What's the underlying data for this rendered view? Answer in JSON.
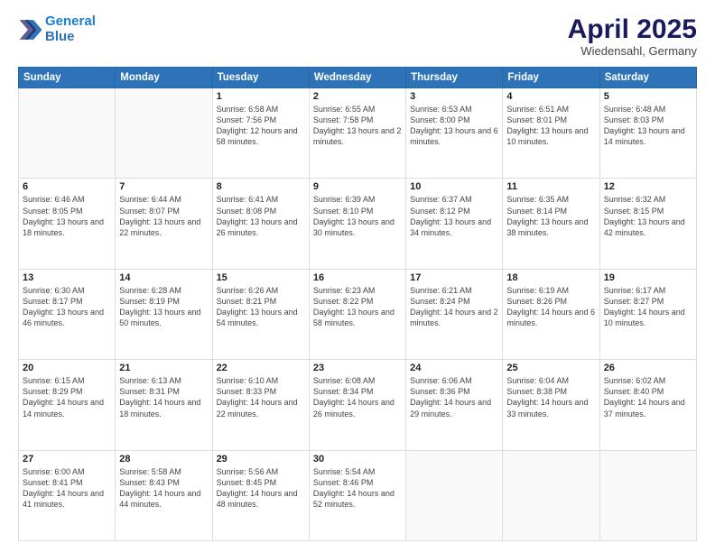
{
  "header": {
    "logo_general": "General",
    "logo_blue": "Blue",
    "month": "April 2025",
    "location": "Wiedensahl, Germany"
  },
  "days_of_week": [
    "Sunday",
    "Monday",
    "Tuesday",
    "Wednesday",
    "Thursday",
    "Friday",
    "Saturday"
  ],
  "weeks": [
    [
      {
        "day": "",
        "detail": ""
      },
      {
        "day": "",
        "detail": ""
      },
      {
        "day": "1",
        "detail": "Sunrise: 6:58 AM\nSunset: 7:56 PM\nDaylight: 12 hours and 58 minutes."
      },
      {
        "day": "2",
        "detail": "Sunrise: 6:55 AM\nSunset: 7:58 PM\nDaylight: 13 hours and 2 minutes."
      },
      {
        "day": "3",
        "detail": "Sunrise: 6:53 AM\nSunset: 8:00 PM\nDaylight: 13 hours and 6 minutes."
      },
      {
        "day": "4",
        "detail": "Sunrise: 6:51 AM\nSunset: 8:01 PM\nDaylight: 13 hours and 10 minutes."
      },
      {
        "day": "5",
        "detail": "Sunrise: 6:48 AM\nSunset: 8:03 PM\nDaylight: 13 hours and 14 minutes."
      }
    ],
    [
      {
        "day": "6",
        "detail": "Sunrise: 6:46 AM\nSunset: 8:05 PM\nDaylight: 13 hours and 18 minutes."
      },
      {
        "day": "7",
        "detail": "Sunrise: 6:44 AM\nSunset: 8:07 PM\nDaylight: 13 hours and 22 minutes."
      },
      {
        "day": "8",
        "detail": "Sunrise: 6:41 AM\nSunset: 8:08 PM\nDaylight: 13 hours and 26 minutes."
      },
      {
        "day": "9",
        "detail": "Sunrise: 6:39 AM\nSunset: 8:10 PM\nDaylight: 13 hours and 30 minutes."
      },
      {
        "day": "10",
        "detail": "Sunrise: 6:37 AM\nSunset: 8:12 PM\nDaylight: 13 hours and 34 minutes."
      },
      {
        "day": "11",
        "detail": "Sunrise: 6:35 AM\nSunset: 8:14 PM\nDaylight: 13 hours and 38 minutes."
      },
      {
        "day": "12",
        "detail": "Sunrise: 6:32 AM\nSunset: 8:15 PM\nDaylight: 13 hours and 42 minutes."
      }
    ],
    [
      {
        "day": "13",
        "detail": "Sunrise: 6:30 AM\nSunset: 8:17 PM\nDaylight: 13 hours and 46 minutes."
      },
      {
        "day": "14",
        "detail": "Sunrise: 6:28 AM\nSunset: 8:19 PM\nDaylight: 13 hours and 50 minutes."
      },
      {
        "day": "15",
        "detail": "Sunrise: 6:26 AM\nSunset: 8:21 PM\nDaylight: 13 hours and 54 minutes."
      },
      {
        "day": "16",
        "detail": "Sunrise: 6:23 AM\nSunset: 8:22 PM\nDaylight: 13 hours and 58 minutes."
      },
      {
        "day": "17",
        "detail": "Sunrise: 6:21 AM\nSunset: 8:24 PM\nDaylight: 14 hours and 2 minutes."
      },
      {
        "day": "18",
        "detail": "Sunrise: 6:19 AM\nSunset: 8:26 PM\nDaylight: 14 hours and 6 minutes."
      },
      {
        "day": "19",
        "detail": "Sunrise: 6:17 AM\nSunset: 8:27 PM\nDaylight: 14 hours and 10 minutes."
      }
    ],
    [
      {
        "day": "20",
        "detail": "Sunrise: 6:15 AM\nSunset: 8:29 PM\nDaylight: 14 hours and 14 minutes."
      },
      {
        "day": "21",
        "detail": "Sunrise: 6:13 AM\nSunset: 8:31 PM\nDaylight: 14 hours and 18 minutes."
      },
      {
        "day": "22",
        "detail": "Sunrise: 6:10 AM\nSunset: 8:33 PM\nDaylight: 14 hours and 22 minutes."
      },
      {
        "day": "23",
        "detail": "Sunrise: 6:08 AM\nSunset: 8:34 PM\nDaylight: 14 hours and 26 minutes."
      },
      {
        "day": "24",
        "detail": "Sunrise: 6:06 AM\nSunset: 8:36 PM\nDaylight: 14 hours and 29 minutes."
      },
      {
        "day": "25",
        "detail": "Sunrise: 6:04 AM\nSunset: 8:38 PM\nDaylight: 14 hours and 33 minutes."
      },
      {
        "day": "26",
        "detail": "Sunrise: 6:02 AM\nSunset: 8:40 PM\nDaylight: 14 hours and 37 minutes."
      }
    ],
    [
      {
        "day": "27",
        "detail": "Sunrise: 6:00 AM\nSunset: 8:41 PM\nDaylight: 14 hours and 41 minutes."
      },
      {
        "day": "28",
        "detail": "Sunrise: 5:58 AM\nSunset: 8:43 PM\nDaylight: 14 hours and 44 minutes."
      },
      {
        "day": "29",
        "detail": "Sunrise: 5:56 AM\nSunset: 8:45 PM\nDaylight: 14 hours and 48 minutes."
      },
      {
        "day": "30",
        "detail": "Sunrise: 5:54 AM\nSunset: 8:46 PM\nDaylight: 14 hours and 52 minutes."
      },
      {
        "day": "",
        "detail": ""
      },
      {
        "day": "",
        "detail": ""
      },
      {
        "day": "",
        "detail": ""
      }
    ]
  ]
}
